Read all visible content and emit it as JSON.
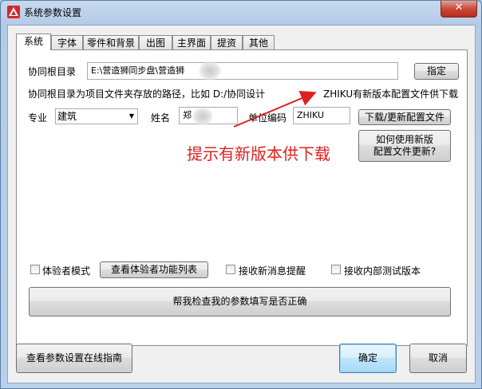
{
  "window": {
    "title": "系统参数设置",
    "close_glyph": "✕"
  },
  "tabs": [
    "系统",
    "字体",
    "零件和背景",
    "出图",
    "主界面",
    "提资",
    "其他"
  ],
  "active_tab": "系统",
  "collab": {
    "label": "协同根目录",
    "value": "E:\\营造狮同步盘\\营造狮",
    "value_tail": "夹",
    "button": "指定"
  },
  "hint": {
    "text": "协同根目录为项目文件夹存放的路径，比如 D:/协同设计",
    "update_notice": "ZHIKU有新版本配置文件供下载"
  },
  "profile": {
    "major_label": "专业",
    "major_value": "建筑",
    "name_label": "姓名",
    "name_value": "郑",
    "unit_label": "单位编码",
    "unit_value": "ZHIKU",
    "download_button": "下载/更新配置文件"
  },
  "how_to_button": "如何使用新版\n配置文件更新?",
  "annotation": {
    "text": "提示有新版本供下载",
    "color": "#e02020"
  },
  "options": {
    "trial_mode_label": "体验者模式",
    "trial_list_button": "查看体验者功能列表",
    "receive_news_label": "接收新消息提醒",
    "receive_beta_label": "接收内部测试版本"
  },
  "check_button": "帮我检查我的参数填写是否正确",
  "footer": {
    "guide_button": "查看参数设置在线指南",
    "ok_button": "确定",
    "cancel_button": "取消"
  }
}
